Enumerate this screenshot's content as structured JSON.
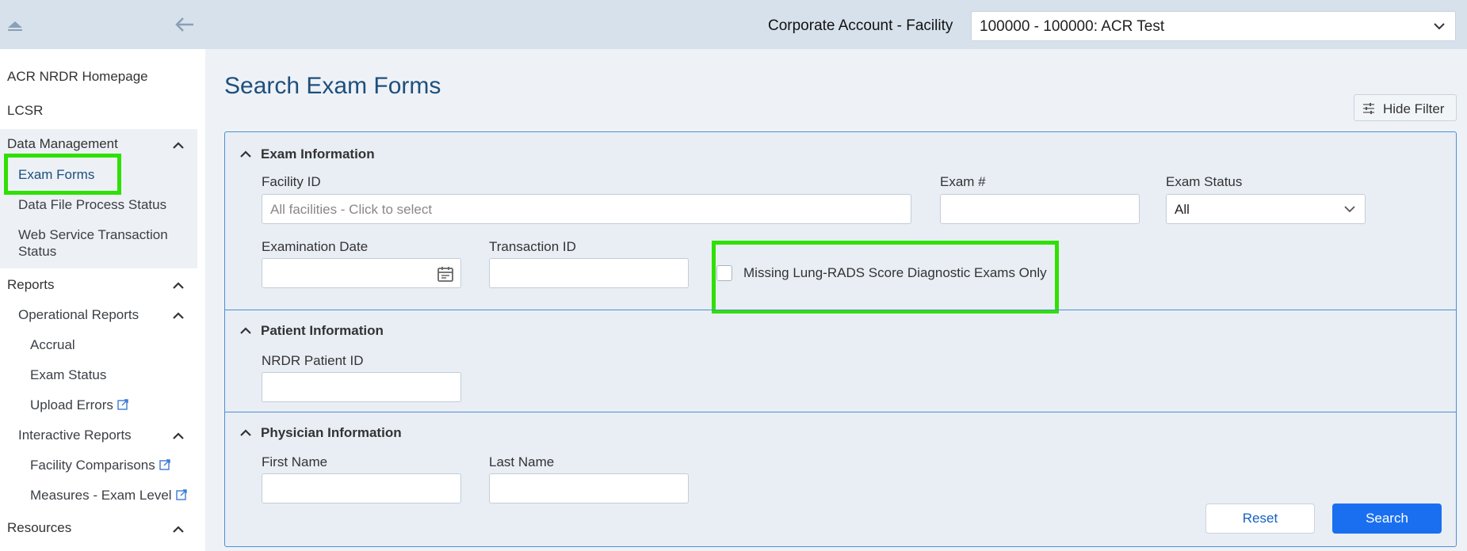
{
  "header": {
    "account_label": "Corporate Account - Facility",
    "facility_selected": "100000 - 100000: ACR Test"
  },
  "sidebar": {
    "items": [
      {
        "label": "ACR NRDR Homepage"
      },
      {
        "label": "LCSR"
      }
    ],
    "data_management": {
      "label": "Data Management",
      "children": [
        "Exam Forms",
        "Data File Process Status",
        "Web Service Transaction Status"
      ]
    },
    "reports": {
      "label": "Reports",
      "operational": {
        "label": "Operational Reports",
        "children": [
          "Accrual",
          "Exam Status",
          "Upload Errors"
        ]
      },
      "interactive": {
        "label": "Interactive Reports",
        "children": [
          "Facility Comparisons",
          "Measures - Exam Level"
        ]
      }
    },
    "resources": {
      "label": "Resources"
    }
  },
  "main": {
    "title": "Search Exam Forms",
    "hide_filter_label": "Hide Filter"
  },
  "exam_info": {
    "title": "Exam Information",
    "facility_id_label": "Facility ID",
    "facility_id_placeholder": "All facilities - Click to select",
    "exam_num_label": "Exam #",
    "exam_num_value": "",
    "exam_status_label": "Exam Status",
    "exam_status_value": "All",
    "exam_date_label": "Examination Date",
    "exam_date_value": "",
    "transaction_id_label": "Transaction ID",
    "transaction_id_value": "",
    "missing_lungrads_label": "Missing Lung-RADS Score Diagnostic Exams Only",
    "missing_lungrads_checked": false
  },
  "patient_info": {
    "title": "Patient Information",
    "nrdr_patient_id_label": "NRDR Patient ID",
    "nrdr_patient_id_value": ""
  },
  "physician_info": {
    "title": "Physician Information",
    "first_name_label": "First Name",
    "first_name_value": "",
    "last_name_label": "Last Name",
    "last_name_value": ""
  },
  "buttons": {
    "reset": "Reset",
    "search": "Search"
  },
  "colors": {
    "accent": "#1a6ff0",
    "highlight": "#2fe000",
    "title": "#1e4f7d",
    "panel_border": "#4d8fd1"
  }
}
